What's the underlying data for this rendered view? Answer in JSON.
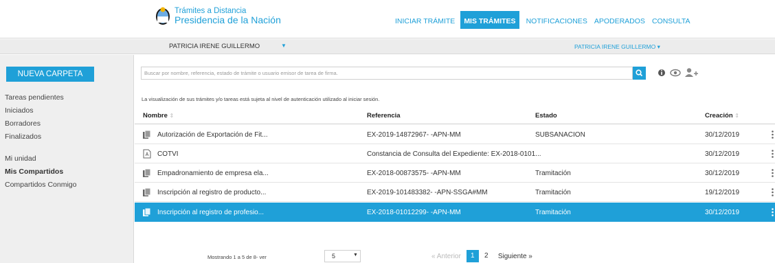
{
  "header": {
    "brand_line1": "Trámites a Distancia",
    "brand_line2": "Presidencia de la Nación",
    "nav": [
      "INICIAR TRÁMITE",
      "MIS TRÁMITES",
      "NOTIFICACIONES",
      "APODERADOS",
      "CONSULTA"
    ],
    "active_nav": "MIS TRÁMITES"
  },
  "userbar": {
    "user_name": "PATRICIA IRENE GUILLERMO",
    "user_caret": "▼",
    "account_name": "PATRICIA IRENE GUILLERMO ▾"
  },
  "sidebar": {
    "new_folder_label": "NUEVA CARPETA",
    "items": [
      "Tareas pendientes",
      "Iniciados",
      "Borradores",
      "Finalizados",
      "Mi unidad",
      "Mis Compartidos",
      "Compartidos Conmigo"
    ],
    "active_item": "Mis Compartidos"
  },
  "search": {
    "placeholder": "Buscar por nombre, referencia, estado de trámite o usuario emisor de tarea de firma."
  },
  "toolbar_icons": [
    "search-icon",
    "info-icon",
    "eye-icon",
    "add-user-icon"
  ],
  "notice": "La visualización de sus trámites y/o tareas está sujeta al nivel de autenticación utilizado al iniciar sesión.",
  "table": {
    "headers": [
      "Nombre",
      "Referencia",
      "Estado",
      "Creación"
    ],
    "sort_glyph": "⇕",
    "rows": [
      {
        "nombre": "Autorización de Exportación de Fit...",
        "referencia": "EX-2019-14872967- -APN-MM",
        "estado": "SUBSANACION",
        "creacion": "30/12/2019",
        "icon": "document-stack-icon",
        "selected": false
      },
      {
        "nombre": "COTVI",
        "referencia": "Constancia de Consulta del Expediente: EX-2018-0101...",
        "estado": "",
        "creacion": "30/12/2019",
        "icon": "pdf-icon",
        "selected": false
      },
      {
        "nombre": "Empadronamiento de empresa ela...",
        "referencia": "EX-2018-00873575- -APN-MM",
        "estado": "Tramitación",
        "creacion": "30/12/2019",
        "icon": "document-stack-icon",
        "selected": false
      },
      {
        "nombre": "Inscripción al registro de producto...",
        "referencia": "EX-2019-101483382- -APN-SSGA#MM",
        "estado": "Tramitación",
        "creacion": "19/12/2019",
        "icon": "document-stack-icon",
        "selected": false
      },
      {
        "nombre": "Inscripción al registro de profesio...",
        "referencia": "EX-2018-01012299- -APN-MM",
        "estado": "Tramitación",
        "creacion": "30/12/2019",
        "icon": "document-stack-icon",
        "selected": true
      }
    ]
  },
  "footer": {
    "showing": "Mostrando 1 a 5 de 8- ver",
    "page_size": "5",
    "page_size_caret": "▼",
    "prev": "« Anterior",
    "pages": [
      "1",
      "2"
    ],
    "current_page": "1",
    "next": "Siguiente »"
  },
  "colors": {
    "accent": "#1fa0d8",
    "sidebar_bg": "#efefef",
    "userbar_bg": "#ececec"
  }
}
